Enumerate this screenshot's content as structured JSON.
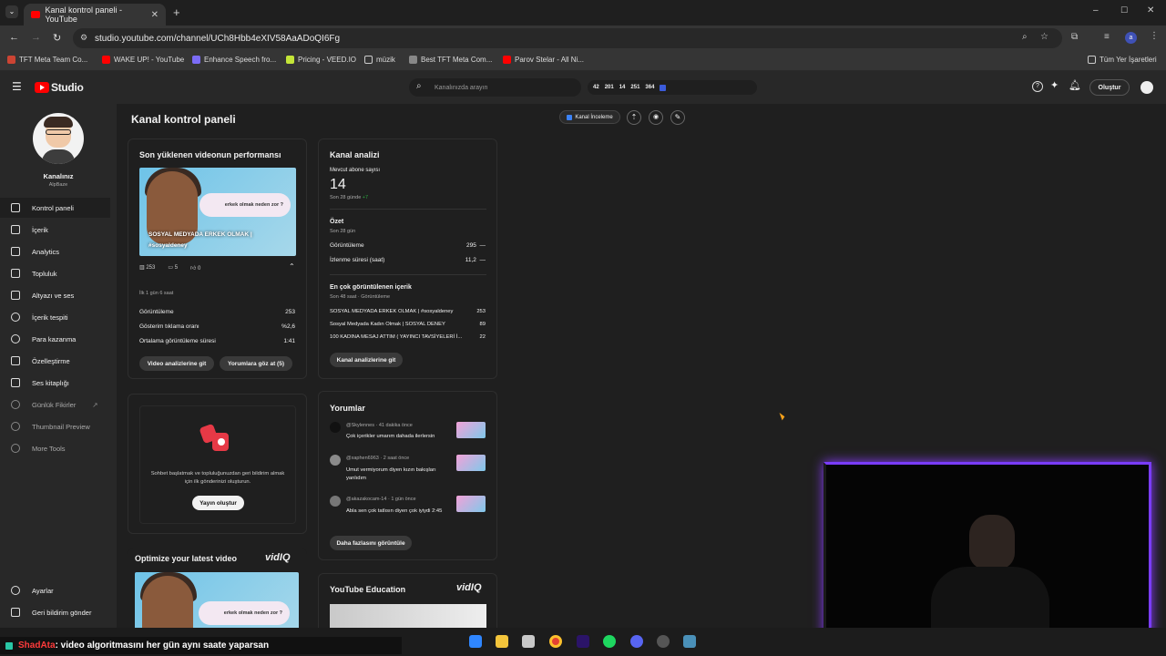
{
  "browser": {
    "tab_title": "Kanal kontrol paneli - YouTube",
    "url": "studio.youtube.com/channel/UCh8Hbb4eXIV58AaADoQI6Fg",
    "profile_initial": "a",
    "bookmarks": [
      "TFT Meta Team Co...",
      "WAKE UP! - YouTube",
      "Enhance Speech fro...",
      "Pricing - VEED.IO",
      "müzik",
      "Best TFT Meta Com...",
      "Parov Stelar - All Ni..."
    ],
    "all_bookmarks": "Tüm Yer İşaretleri"
  },
  "header": {
    "logo_text": "Studio",
    "search_placeholder": "Kanalınızda arayın",
    "stats": [
      "42",
      "201",
      "14",
      "251",
      "364"
    ],
    "create_label": "Oluştur"
  },
  "sidebar": {
    "channel_name": "Kanalınız",
    "channel_handle": "AlpBaze",
    "items": [
      {
        "label": "Kontrol paneli",
        "icon": "dashboard-icon"
      },
      {
        "label": "İçerik",
        "icon": "content-icon"
      },
      {
        "label": "Analytics",
        "icon": "analytics-icon"
      },
      {
        "label": "Topluluk",
        "icon": "community-icon"
      },
      {
        "label": "Altyazı ve ses",
        "icon": "subtitles-icon"
      },
      {
        "label": "İçerik tespiti",
        "icon": "copyright-icon"
      },
      {
        "label": "Para kazanma",
        "icon": "money-icon"
      },
      {
        "label": "Özelleştirme",
        "icon": "customize-icon"
      },
      {
        "label": "Ses kitaplığı",
        "icon": "audio-library-icon"
      }
    ],
    "extra_items": [
      "Günlük Fikirler",
      "Thumbnail Preview",
      "More Tools"
    ],
    "bottom_items": [
      "Ayarlar",
      "Geri bildirim gönder"
    ]
  },
  "main": {
    "page_title": "Kanal kontrol paneli",
    "actions": {
      "review": "Kanal İnceleme"
    },
    "latest_video": {
      "title": "Son yüklenen videonun performansı",
      "thumb_caption": "SOSYAL MEDYADA ERKEK OLMAK | #sosyaldeney",
      "bubble_text": "erkek olmak neden zor ?",
      "views": "253",
      "comments": "5",
      "likes": "0",
      "since": "İlk 1 gün 6 saat",
      "rows": [
        {
          "label": "Görüntüleme",
          "value": "253"
        },
        {
          "label": "Gösterim tıklama oranı",
          "value": "%2,6"
        },
        {
          "label": "Ortalama görüntüleme süresi",
          "value": "1:41"
        }
      ],
      "btn_analytics": "Video analizlerine git",
      "btn_comments": "Yorumlara göz at (5)"
    },
    "channel_analytics": {
      "title": "Kanal analizi",
      "subs_label": "Mevcut abone sayısı",
      "subs_value": "14",
      "subs_change": "Son 28 günde",
      "subs_delta": "+7",
      "summary_title": "Özet",
      "summary_period": "Son 28 gün",
      "summary_rows": [
        {
          "label": "Görüntüleme",
          "value": "295",
          "trend": "—"
        },
        {
          "label": "İzlenme süresi (saat)",
          "value": "11,2",
          "trend": "—"
        }
      ],
      "top_title": "En çok görüntülenen içerik",
      "top_period": "Son 48 saat · Görüntüleme",
      "top_rows": [
        {
          "label": "SOSYAL MEDYADA ERKEK OLMAK | #sosyaldeney",
          "value": "253"
        },
        {
          "label": "Sosyal Medyada Kadın Olmak | SOSYAL DENEY",
          "value": "89"
        },
        {
          "label": "100 KADINA MESAJ ATTIM ( YAYINCI TAVSİYELERİ İ...",
          "value": "22"
        }
      ],
      "btn": "Kanal analizlerine git"
    },
    "posts": {
      "text": "Sohbet başlatmak ve topluluğunuzdan geri bildirim almak için ilk gönderinizi oluşturun.",
      "btn": "Yayın oluştur"
    },
    "comments": {
      "title": "Yorumlar",
      "items": [
        {
          "user": "@Skylennes",
          "time": "41 dakika önce",
          "text": "Çok içerikler umarım dahada ilerlersin"
        },
        {
          "user": "@xaphen6963",
          "time": "2 saat önce",
          "text": "Umut vermiyorum diyen kızın bakışları yanlıdım"
        },
        {
          "user": "@akazakocam-14",
          "time": "1 gün önce",
          "text": "Abla sen çok tatlısın diyen çok iyiydi 2:45"
        }
      ],
      "btn": "Daha fazlasını görüntüle"
    },
    "optimize": {
      "title": "Optimize your latest video",
      "brand": "vidIQ"
    },
    "education": {
      "title": "YouTube Education",
      "brand": "vidIQ"
    }
  },
  "overlay": {
    "username": "ShadAta",
    "message": ": video algoritmasını her gün aynı saate yaparsan"
  },
  "colors": {
    "accent": "#ff0000",
    "green": "#2ba640",
    "webcam_glow": "#8a3cff"
  }
}
